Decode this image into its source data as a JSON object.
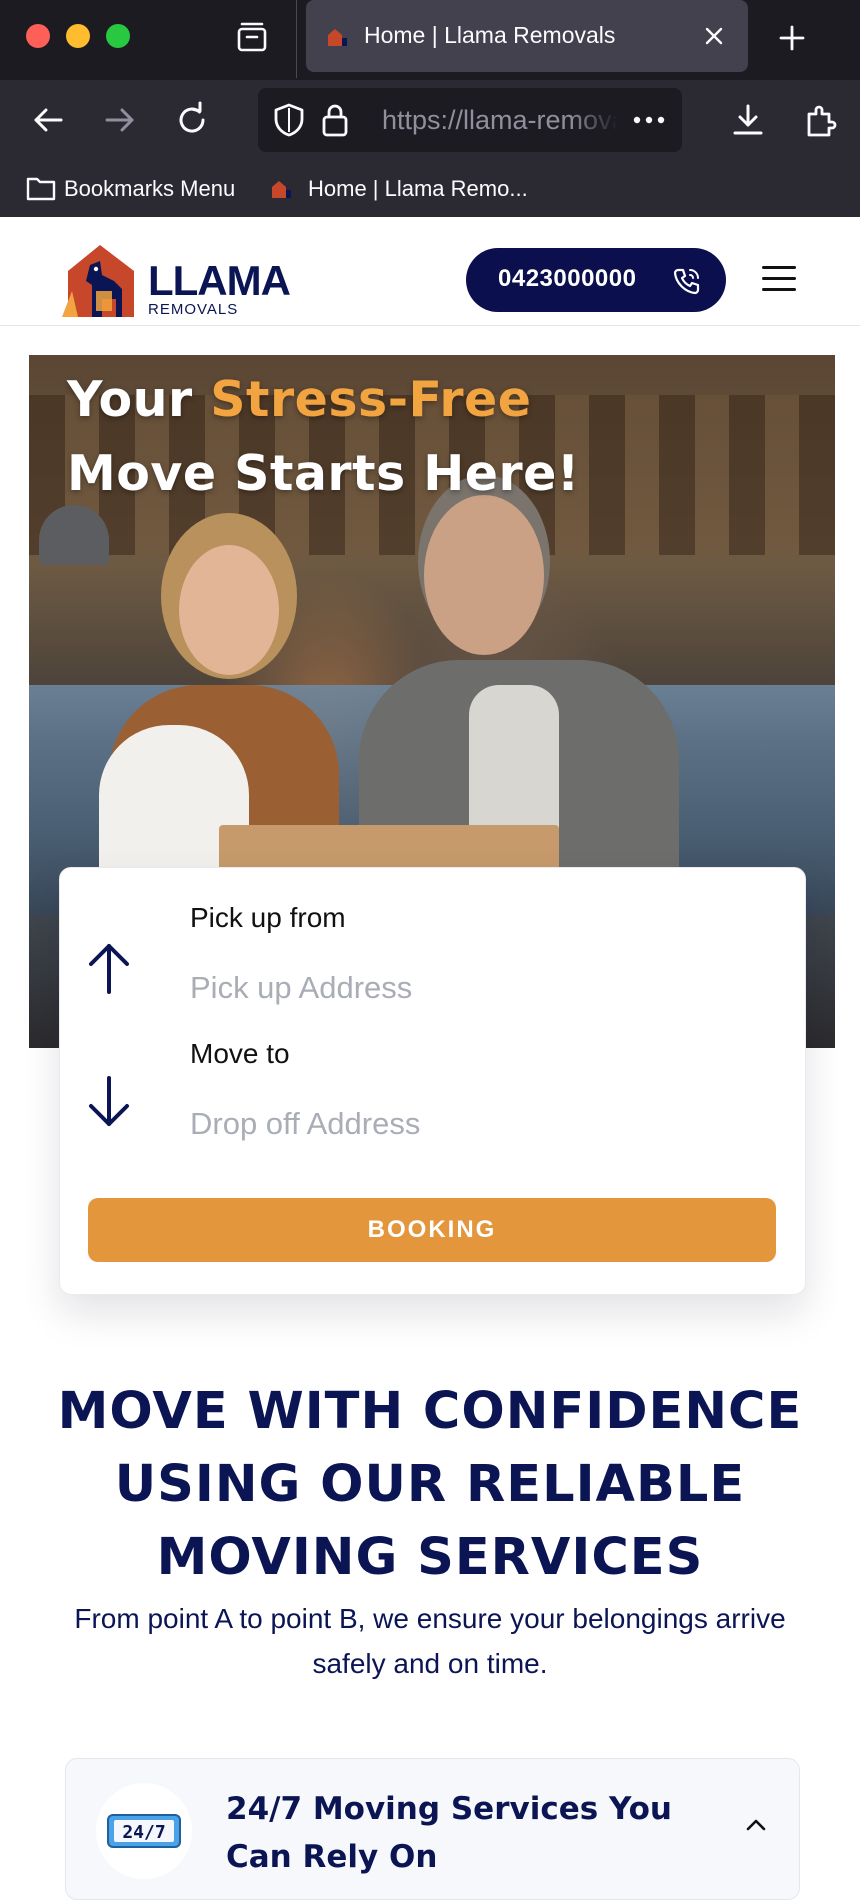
{
  "browser": {
    "tab_title": "Home | Llama Removals",
    "url": "https://llama-removals.com.au",
    "bookmarks": [
      "Bookmarks Menu",
      "Home | Llama Remo..."
    ]
  },
  "header": {
    "logo_word": "LLAMA",
    "logo_sub": "REMOVALS",
    "phone": "0423000000"
  },
  "hero": {
    "headline_part1": "Your ",
    "headline_accent": "Stress-Free",
    "headline_line2": "Move Starts Here!"
  },
  "booking": {
    "pickup_label": "Pick up from",
    "pickup_placeholder": "Pick up Address",
    "dropoff_label": "Move to",
    "dropoff_placeholder": "Drop off Address",
    "button_label": "BOOKING"
  },
  "confidence": {
    "title": "MOVE WITH CONFIDENCE USING OUR RELIABLE MOVING SERVICES",
    "subtitle": "From point A to point B, we ensure your belongings arrive safely and on time."
  },
  "services": [
    {
      "title": "24/7 Moving Services You Can Rely On",
      "icon": "24-7-icon",
      "icon_text": "24/7",
      "expanded": true
    }
  ],
  "colors": {
    "navy": "#0b1554",
    "accent_orange": "#e3963c",
    "headline_orange": "#f2a440"
  }
}
